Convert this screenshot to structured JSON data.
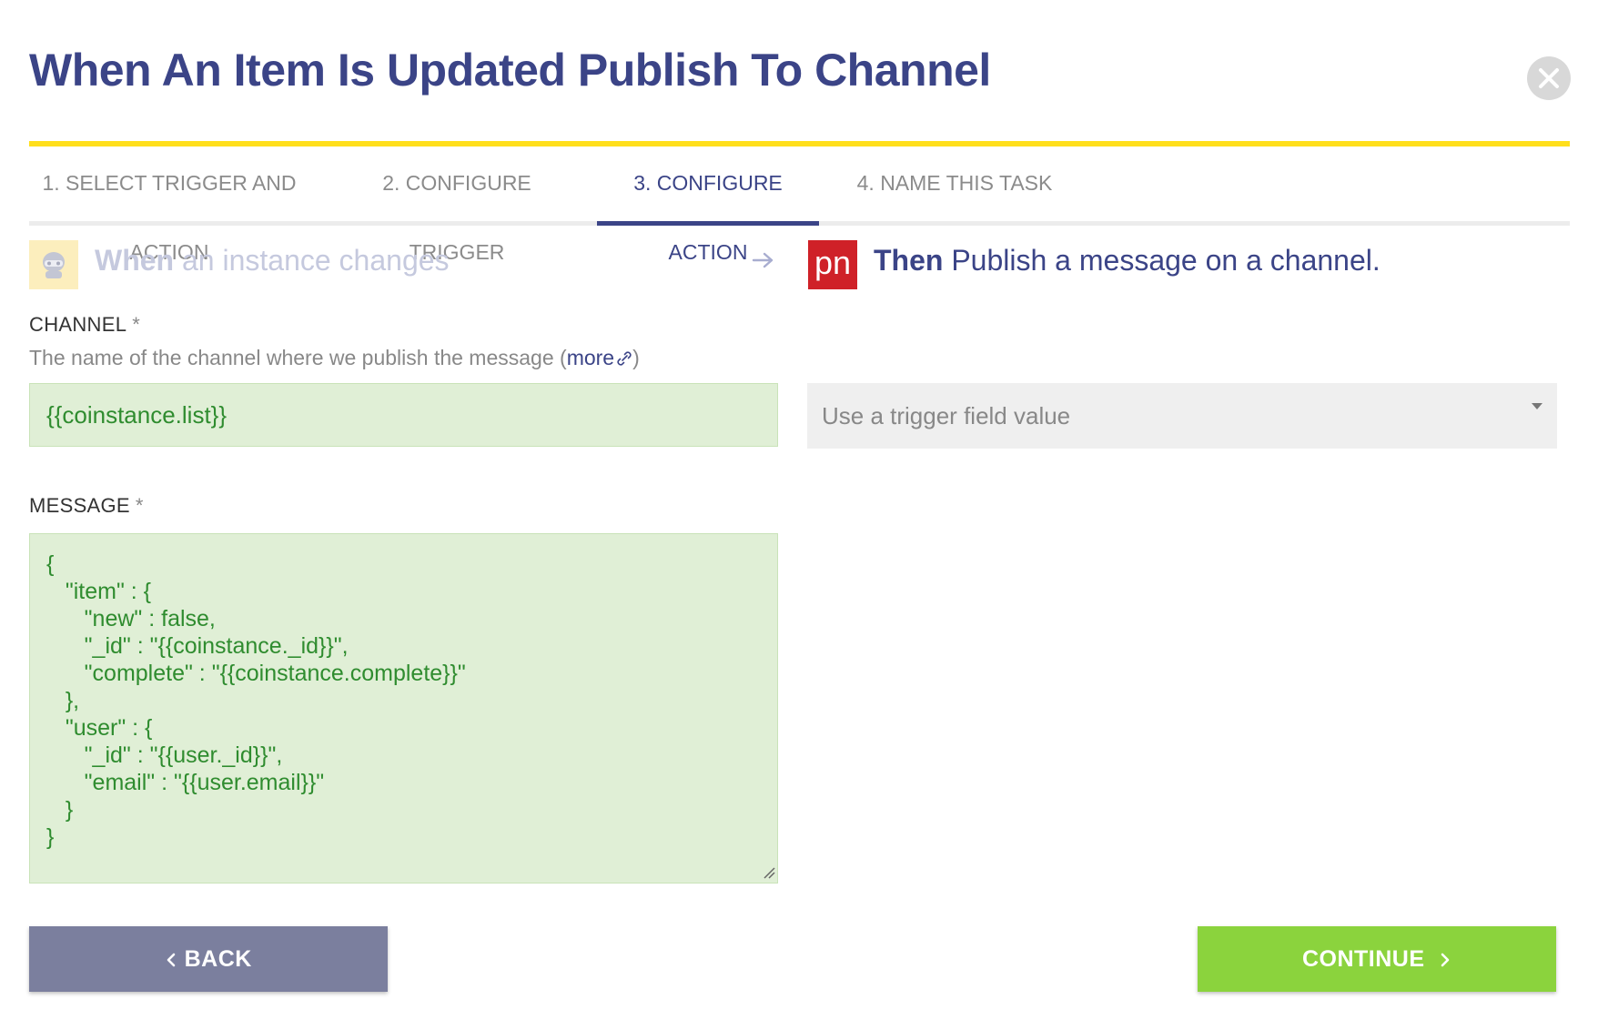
{
  "modal": {
    "title": "When An Item Is Updated Publish To Channel"
  },
  "tabs": [
    {
      "label": "1. SELECT TRIGGER AND ACTION"
    },
    {
      "label": "2. CONFIGURE TRIGGER"
    },
    {
      "label": "3. CONFIGURE ACTION",
      "active": true
    },
    {
      "label": "4. NAME THIS TASK"
    }
  ],
  "summary": {
    "trigger_prefix": "When",
    "trigger_text": " an instance changes",
    "action_icon_text": "pn",
    "action_prefix": "Then",
    "action_text": " Publish a message on a channel."
  },
  "channel": {
    "label": "CHANNEL",
    "required_mark": "*",
    "description": "The name of the channel where we publish the message (",
    "more_link": "more",
    "description_end": ")",
    "value": "{{coinstance.list}}",
    "select_placeholder": "Use a trigger field value"
  },
  "message": {
    "label": "MESSAGE",
    "required_mark": "*",
    "value": "{\n   \"item\" : {\n      \"new\" : false,\n      \"_id\" : \"{{coinstance._id}}\",\n      \"complete\" : \"{{coinstance.complete}}\"\n   },\n   \"user\" : {\n      \"_id\" : \"{{user._id}}\",\n      \"email\" : \"{{user.email}}\"\n   }\n}"
  },
  "buttons": {
    "back": "BACK",
    "continue": "CONTINUE"
  },
  "colors": {
    "primary": "#3b4487",
    "accent": "#ffdf1c",
    "field_bg": "#e0efd6",
    "field_text": "#2f8c2f",
    "back_button": "#7b7f9e",
    "continue_button": "#8bd33d",
    "pubnub_red": "#cf2128"
  },
  "icons": {
    "close": "close-icon",
    "trigger": "robot-trigger-icon",
    "arrow": "arrow-right-icon",
    "action": "pubnub-logo-icon",
    "link": "external-link-icon"
  }
}
